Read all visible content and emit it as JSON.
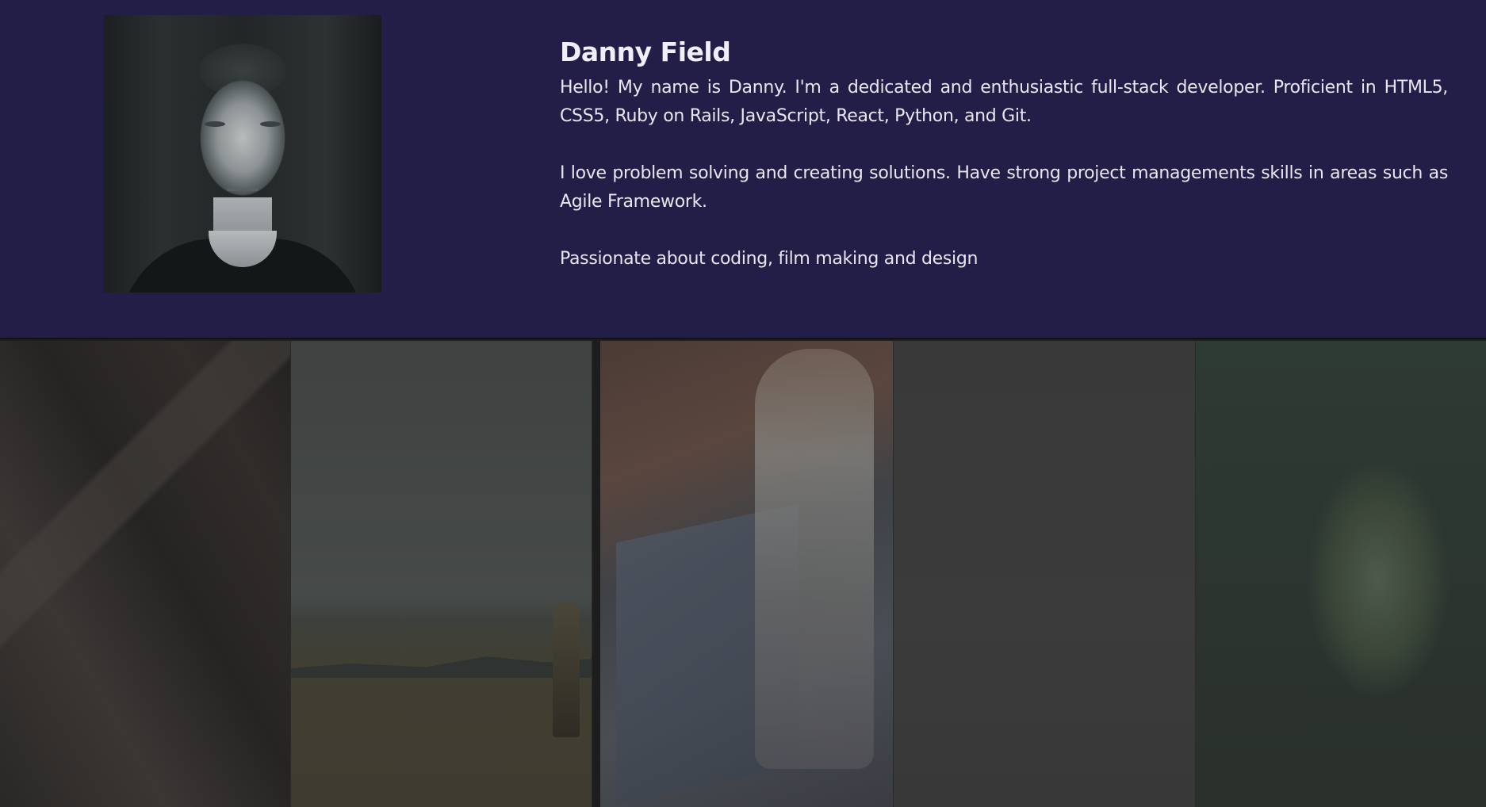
{
  "profile": {
    "name": "Danny Field",
    "paragraphs": [
      "Hello! My name is Danny. I'm a dedicated and enthusiastic full-stack developer. Proficient in HTML5, CSS5, Ruby on Rails, JavaScript, React, Python, and Git.",
      "I love problem solving and creating solutions. Have strong project managements skills in areas such as Agile Framework.",
      "Passionate about coding, film making and design"
    ]
  },
  "colors": {
    "header_bg": "#231e47",
    "text": "#e9e6f2",
    "gallery_bg": "#1f1f22"
  }
}
